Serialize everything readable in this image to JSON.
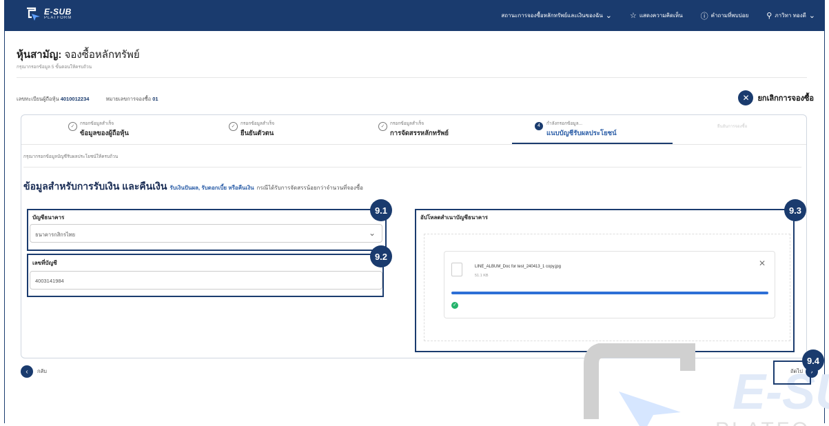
{
  "nav": {
    "logo_title": "E-SUB",
    "logo_sub": "PLATFORM",
    "menu_status": "สถานะการจองซื้อหลักทรัพย์และเงินของฉัน",
    "menu_favorite": "แสดงความคิดเห็น",
    "menu_help": "คำถามที่พบบ่อย",
    "menu_user": "ภาวิทา ทองดี"
  },
  "page": {
    "title_bold": "หุ้นสามัญ:",
    "title_rest": " จองซื้อหลักทรัพย์",
    "subtitle": "กรุณากรอกข้อมูล 5 ขั้นตอนให้ครบถ้วน",
    "holder_label": "เลขทะเบียนผู้ถือหุ้น",
    "holder_value": "4010012234",
    "order_label": "หมายเลขการจองซื้อ",
    "order_value": "01",
    "cancel_label": "ยกเลิกการจองซื้อ"
  },
  "steps": [
    {
      "caption": "กรอกข้อมูลสำเร็จ",
      "label": "ข้อมูลของผู้ถือหุ้น"
    },
    {
      "caption": "กรอกข้อมูลสำเร็จ",
      "label": "ยืนยันตัวตน"
    },
    {
      "caption": "กรอกข้อมูลสำเร็จ",
      "label": "การจัดสรรหลักทรัพย์"
    },
    {
      "caption": "กำลังกรอกข้อมูล...",
      "label": "แนบบัญชีรับผลประโยชน์",
      "number": "4"
    },
    {
      "caption": "ยืนยันการจองซื้อ"
    }
  ],
  "form": {
    "instruction": "กรุณากรอกข้อมูลบัญชีรับผลประโยชน์ให้ครบถ้วน",
    "section_title": "ข้อมูลสำหรับการรับเงิน และคืนเงิน",
    "section_highlight": "รับเงินปันผล, รับดอกเบี้ย หรือคืนเงิน",
    "section_rest": "กรณีได้รับการจัดสรรน้อยกว่าจำนวนที่จองซื้อ",
    "bank_label": "บัญชีธนาคาร",
    "bank_value": "ธนาคารกสิกรไทย",
    "account_label": "เลขที่บัญชี",
    "account_value": "4003141984",
    "upload_label": "อัปโหลดสำเนาบัญชีธนาคาร",
    "file_name": "LINE_ALBUM_Doc for test_240413_1 copy.jpg",
    "file_size": "51.1 KB",
    "upload_progress_pct": 100
  },
  "badges": {
    "b1": "9.1",
    "b2": "9.2",
    "b3": "9.3",
    "b4": "9.4"
  },
  "footer": {
    "back_label": "กลับ",
    "next_label": "ถัดไป"
  },
  "colors": {
    "brand_navy": "#1a3b6e",
    "link_blue": "#2d5fa8",
    "progress_blue": "#2d6fd6",
    "success_green": "#25b36b"
  },
  "icons": {
    "star": "star-icon",
    "help": "question-circle-icon",
    "user": "user-icon",
    "close": "close-icon",
    "check": "check-circle-icon"
  }
}
